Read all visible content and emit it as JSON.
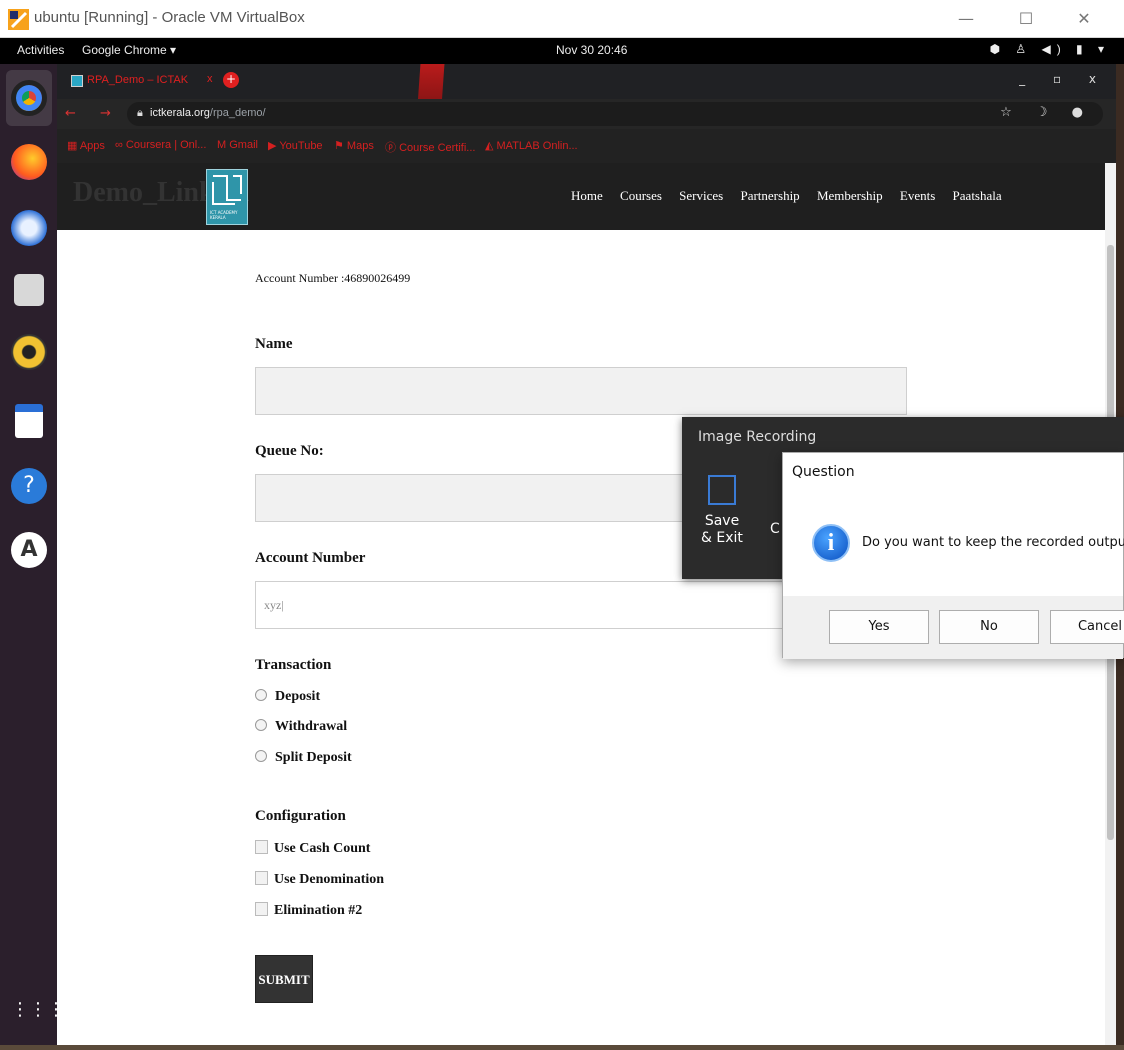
{
  "host_window": {
    "title": "ubuntu [Running] - Oracle VM VirtualBox",
    "minimize": "—",
    "maximize": "☐",
    "close": "✕"
  },
  "gnome_bar": {
    "activities": "Activities",
    "app_menu": "Google Chrome ▾",
    "clock": "Nov 30  20:46",
    "tray": "⬢ ♙ ◀) ▮ ▾"
  },
  "chrome": {
    "tab_title": "RPA_Demo – ICTAK",
    "tab_close": "x",
    "new_tab": "+",
    "window_controls": "_ ▫ x",
    "url_domain": "ictkerala.org",
    "url_path": "/rpa_demo/",
    "bookmarks": [
      "Apps",
      "Coursera | Onl...",
      "Gmail",
      "YouTube",
      "Maps",
      "Course Certifi...",
      "MATLAB Onlin..."
    ]
  },
  "site": {
    "brand": "Demo_Link_R",
    "logo_text": "ICT ACADEMY KERALA",
    "nav": [
      "Home",
      "Courses",
      "Services",
      "Partnership",
      "Membership",
      "Events",
      "Paatshala"
    ]
  },
  "form": {
    "account_number_text": "Account Number :46890026499",
    "name_label": "Name",
    "name_value": "",
    "queue_label": "Queue No:",
    "queue_value": "",
    "account_label": "Account Number",
    "account_value": "xyz|",
    "transaction_label": "Transaction",
    "transactions": [
      "Deposit",
      "Withdrawal",
      "Split Deposit"
    ],
    "configuration_label": "Configuration",
    "configurations": [
      "Use Cash Count",
      "Use Denomination",
      "Elimination #2"
    ],
    "submit": "SUBMIT"
  },
  "image_recording": {
    "title": "Image Recording",
    "save_exit": "Save & Exit",
    "next_partial": "C In"
  },
  "dialog": {
    "title": "Question",
    "message": "Do you want to keep the recorded output ?",
    "yes": "Yes",
    "no": "No",
    "cancel": "Cancel"
  },
  "colors": {
    "accent_red": "#d42020",
    "dialog_blue": "#0a4fc0",
    "site_nav_bg": "#1f1f1f"
  }
}
